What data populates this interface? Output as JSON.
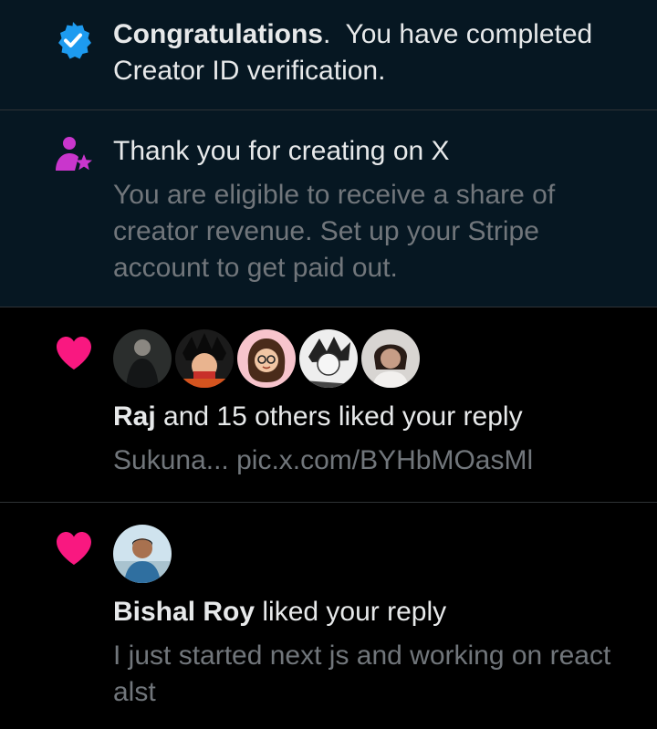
{
  "notifications": [
    {
      "type": "verification",
      "icon": "verified-badge-icon",
      "title_bold": "Congratulations",
      "title_rest": ".  You have completed Creator ID verification."
    },
    {
      "type": "creator-revenue",
      "icon": "creator-star-icon",
      "title": "Thank you for creating on X",
      "body": "You are eligible to receive a share of creator revenue. Set up your Stripe account to get paid out."
    },
    {
      "type": "like",
      "icon": "heart-icon",
      "actor": "Raj",
      "action": " and 15 others liked your reply",
      "snippet": "Sukuna... pic.x.com/BYHbMOasMl",
      "avatar_count": 5
    },
    {
      "type": "like",
      "icon": "heart-icon",
      "actor": "Bishal Roy",
      "action": " liked your reply",
      "snippet": "I just started next js and working on react alst"
    }
  ],
  "colors": {
    "verified_blue": "#1d9bf0",
    "creator_purple": "#c936cc",
    "like_pink": "#f91880",
    "unread_bg": "#061722",
    "muted_text": "#71767b"
  }
}
